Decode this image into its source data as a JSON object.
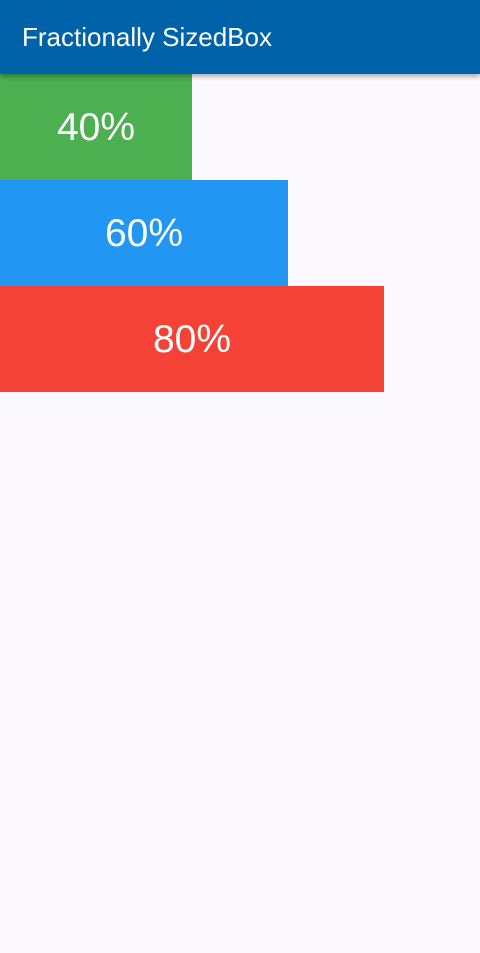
{
  "app_bar": {
    "title": "Fractionally SizedBox",
    "background_color": "#0062a9"
  },
  "boxes": [
    {
      "label": "40%",
      "width_fraction": 0.4,
      "color": "#4caf50"
    },
    {
      "label": "60%",
      "width_fraction": 0.6,
      "color": "#2196f3"
    },
    {
      "label": "80%",
      "width_fraction": 0.8,
      "color": "#f44336"
    }
  ],
  "page": {
    "background_color": "#fcf9fe"
  }
}
